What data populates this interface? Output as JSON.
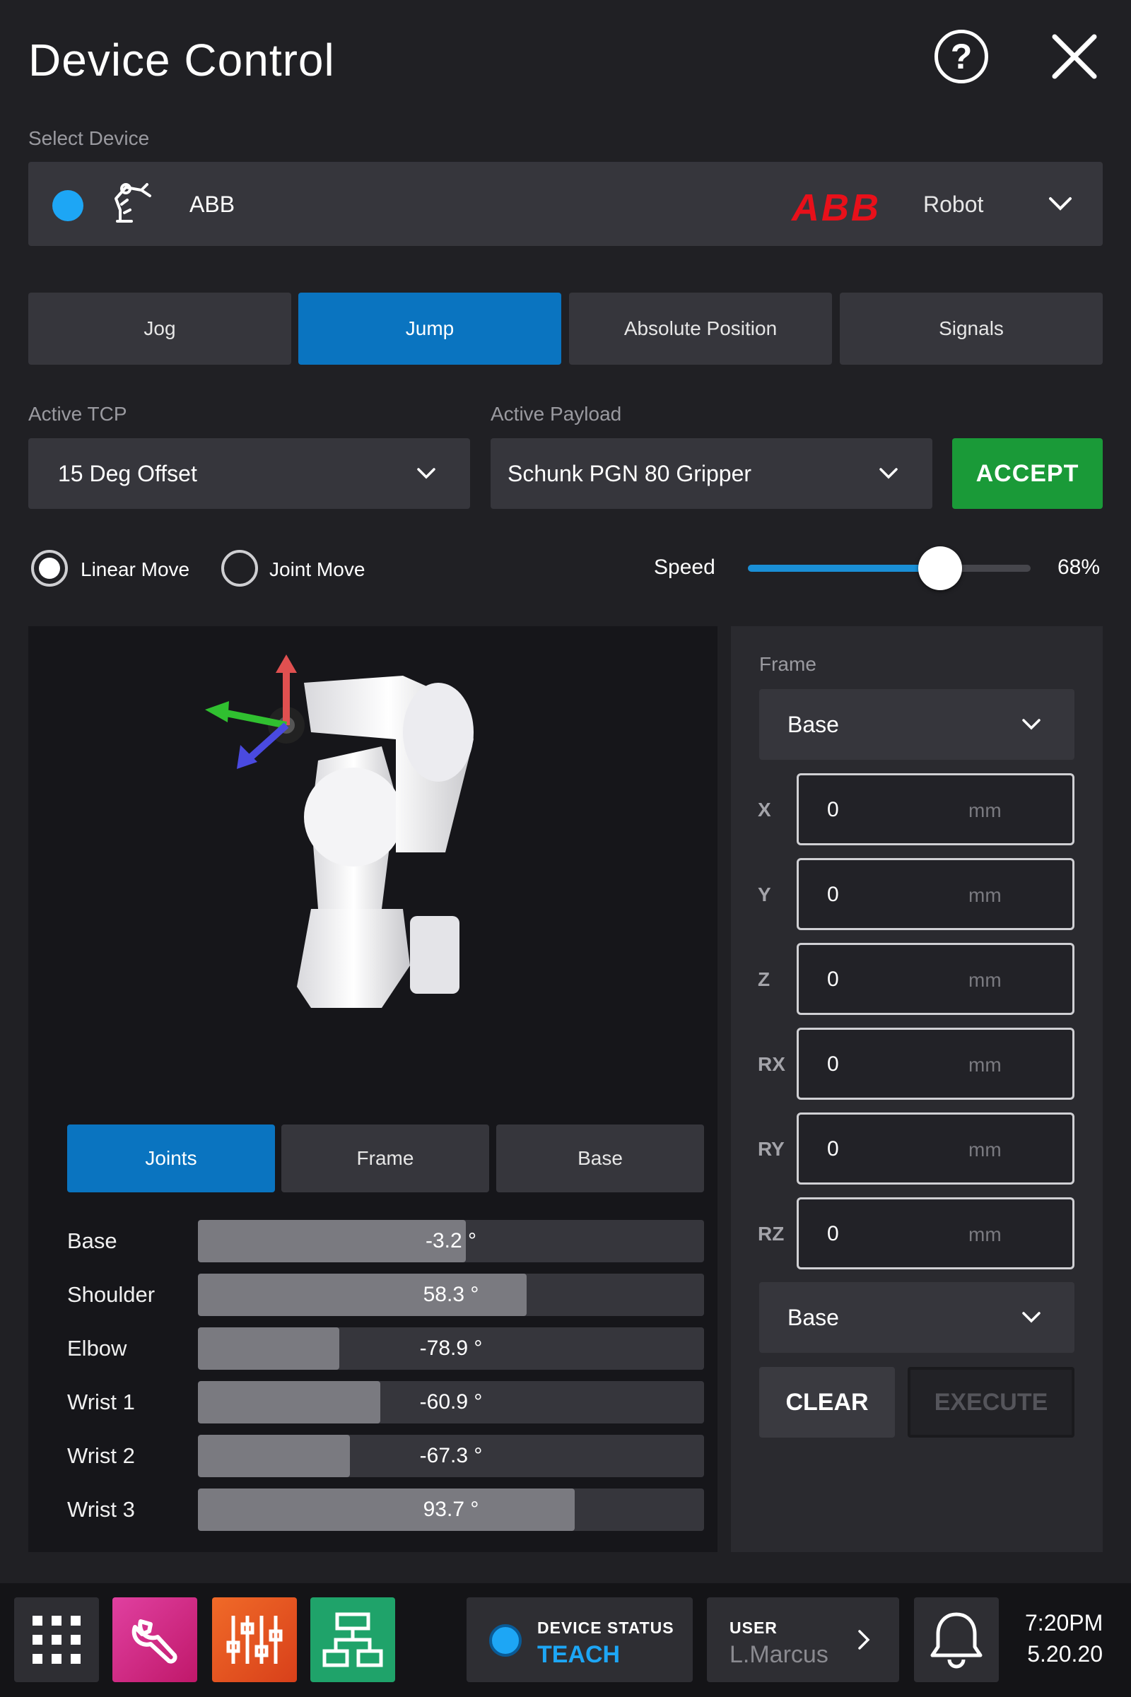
{
  "header": {
    "title": "Device Control"
  },
  "select_device": {
    "label": "Select Device",
    "name": "ABB",
    "brand": "ABB",
    "type": "Robot",
    "status_color": "#1da6f5"
  },
  "tabs": [
    {
      "label": "Jog",
      "active": false
    },
    {
      "label": "Jump",
      "active": true
    },
    {
      "label": "Absolute Position",
      "active": false
    },
    {
      "label": "Signals",
      "active": false
    }
  ],
  "tcp": {
    "label": "Active TCP",
    "value": "15 Deg Offset"
  },
  "payload": {
    "label": "Active Payload",
    "value": "Schunk PGN 80 Gripper"
  },
  "accept_label": "ACCEPT",
  "move": {
    "linear_label": "Linear Move",
    "joint_label": "Joint Move",
    "selected": "linear"
  },
  "speed": {
    "label": "Speed",
    "value": 68,
    "display": "68%"
  },
  "view_tabs": [
    {
      "label": "Joints",
      "active": true
    },
    {
      "label": "Frame",
      "active": false
    },
    {
      "label": "Base",
      "active": false
    }
  ],
  "joints": [
    {
      "name": "Base",
      "value": "-3.2 °",
      "fill": 0.53
    },
    {
      "name": "Shoulder",
      "value": "58.3 °",
      "fill": 0.65
    },
    {
      "name": "Elbow",
      "value": "-78.9 °",
      "fill": 0.28
    },
    {
      "name": "Wrist 1",
      "value": "-60.9 °",
      "fill": 0.36
    },
    {
      "name": "Wrist 2",
      "value": "-67.3 °",
      "fill": 0.3
    },
    {
      "name": "Wrist 3",
      "value": "93.7 °",
      "fill": 0.745
    }
  ],
  "frame": {
    "label": "Frame",
    "value": "Base",
    "coords": [
      {
        "axis": "X",
        "value": "0",
        "unit": "mm"
      },
      {
        "axis": "Y",
        "value": "0",
        "unit": "mm"
      },
      {
        "axis": "Z",
        "value": "0",
        "unit": "mm"
      },
      {
        "axis": "RX",
        "value": "0",
        "unit": "mm"
      },
      {
        "axis": "RY",
        "value": "0",
        "unit": "mm"
      },
      {
        "axis": "RZ",
        "value": "0",
        "unit": "mm"
      }
    ],
    "ref_value": "Base",
    "clear_label": "CLEAR",
    "execute_label": "EXECUTE"
  },
  "bottom": {
    "device_status_label": "DEVICE STATUS",
    "device_status_value": "TEACH",
    "user_label": "USER",
    "user_name": "L.Marcus",
    "time": "7:20PM",
    "date": "5.20.20",
    "app_colors": [
      "#2e2e33",
      "#d12c8f",
      "#e8521e",
      "#1fa36a"
    ]
  }
}
